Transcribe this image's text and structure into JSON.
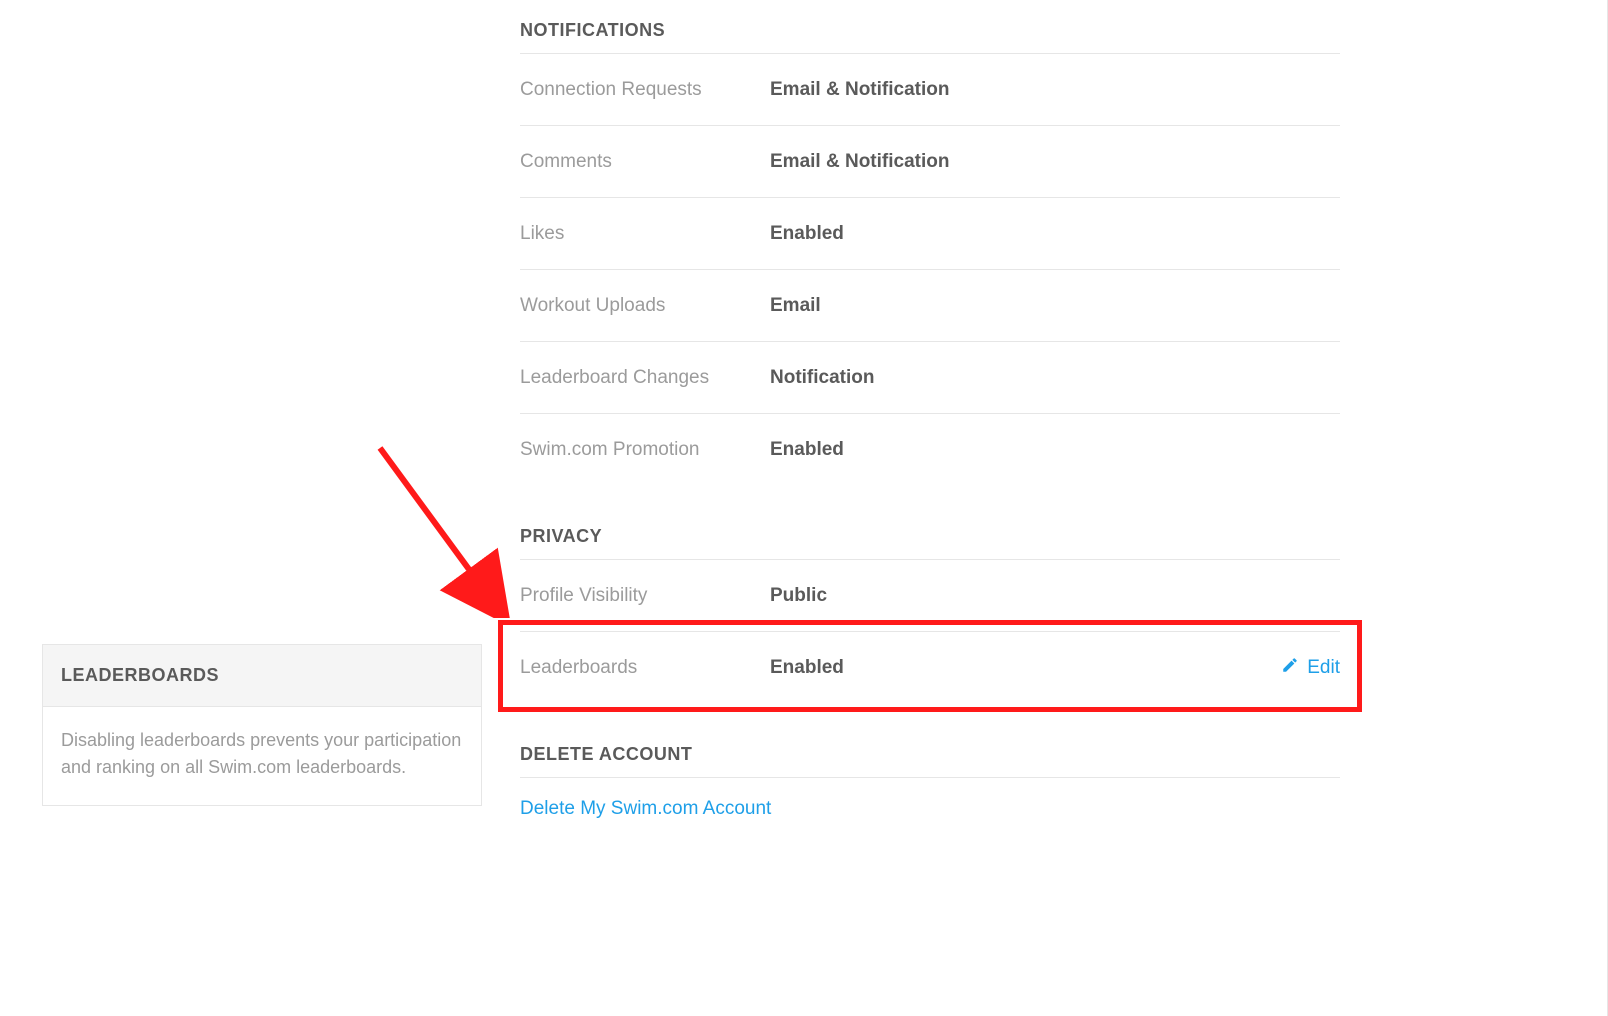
{
  "notifications": {
    "title": "NOTIFICATIONS",
    "rows": [
      {
        "label": "Connection Requests",
        "value": "Email & Notification"
      },
      {
        "label": "Comments",
        "value": "Email & Notification"
      },
      {
        "label": "Likes",
        "value": "Enabled"
      },
      {
        "label": "Workout Uploads",
        "value": "Email"
      },
      {
        "label": "Leaderboard Changes",
        "value": "Notification"
      },
      {
        "label": "Swim.com Promotion",
        "value": "Enabled"
      }
    ]
  },
  "privacy": {
    "title": "PRIVACY",
    "rows": [
      {
        "label": "Profile Visibility",
        "value": "Public"
      },
      {
        "label": "Leaderboards",
        "value": "Enabled",
        "edit": "Edit"
      }
    ]
  },
  "delete": {
    "title": "DELETE ACCOUNT",
    "link": "Delete My Swim.com Account"
  },
  "sidebar_card": {
    "title": "LEADERBOARDS",
    "body": "Disabling leaderboards prevents your participation and ranking on all Swim.com leaderboards."
  }
}
